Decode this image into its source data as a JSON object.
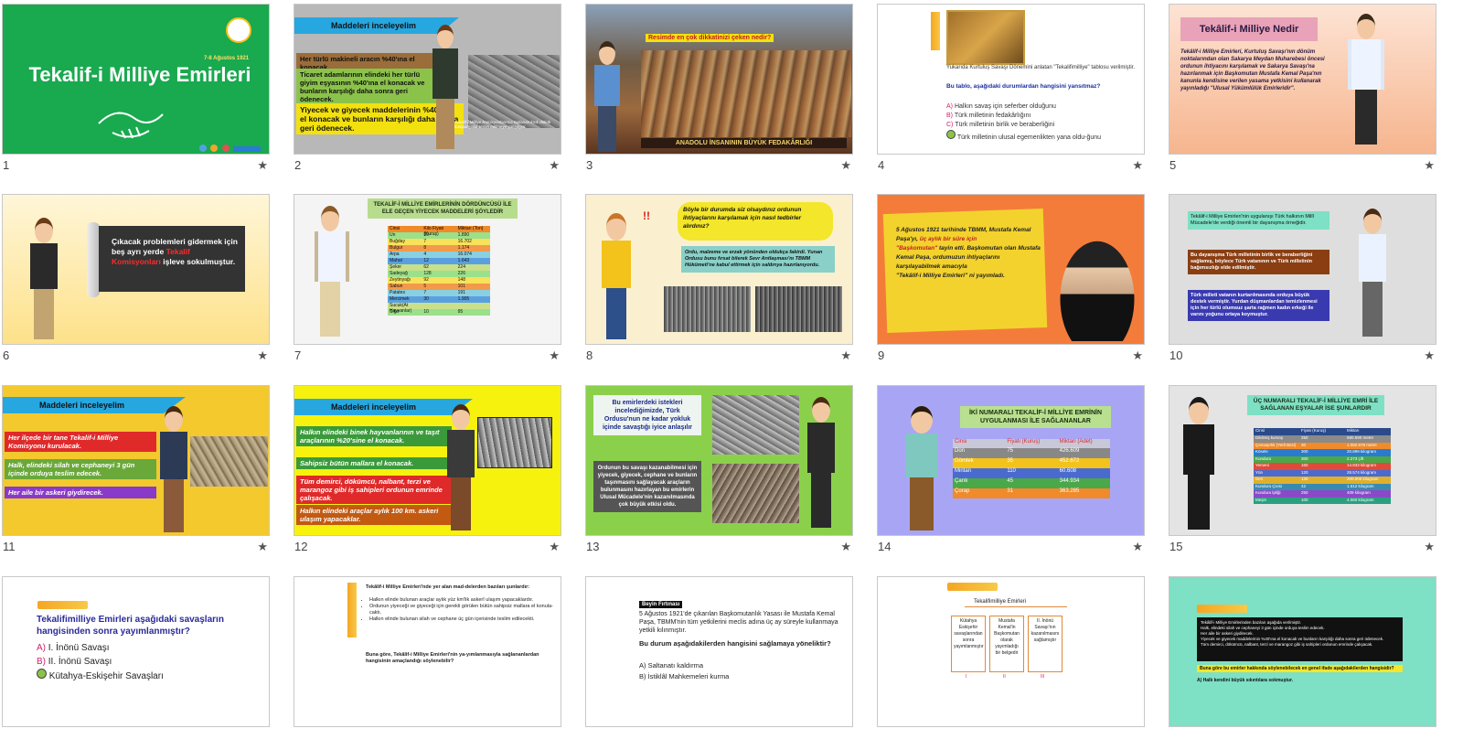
{
  "slides": [
    {
      "num": "1",
      "title": "Tekalif-i Milliye Emirleri",
      "date": "7-8 Ağustos 1921"
    },
    {
      "num": "2",
      "banner": "Maddeleri inceleyelim",
      "lines": [
        "Her türlü makineli aracın %40'ına el konacak.",
        "Ticaret adamlarının elindeki her türlü giyim eşyasının %40'ına el konacak ve bunların karşılığı daha sonra geri ödenecek.",
        "Yiyecek ve giyecek maddelerinin %40'ına el konacak ve bunların karşılığı daha sonra geri ödenecek."
      ],
      "caption": "Tekalif-i Milliye Komisyonlarınca toplanan kırık dökük kampanyalar temin edilmeye çalışılıyor."
    },
    {
      "num": "3",
      "question": "Resimde en çok dikkatinizi çeken nedir?",
      "caption": "ANADOLU İNSANININ BÜYÜK FEDAKÂRLIĞI"
    },
    {
      "num": "4",
      "intro": "Yukarıda Kurtuluş Savaşı Dönemini anlatan \"Tekalifimilliye\" tablosu verilmiştir.",
      "question": "Bu tablo, aşağıdaki durumlardan hangisini yansıtmaz?",
      "options": [
        "Halkın savaş için seferber olduğunu",
        "Türk milletinin fedakârlığını",
        "Türk milletinin birlik ve beraberliğini",
        "Türk milletinin ulusal egemenlikten yana oldu-ğunu"
      ],
      "letters": [
        "A)",
        "B)",
        "C)",
        "D)"
      ]
    },
    {
      "num": "5",
      "title": "Tekâlif-i Milliye Nedir",
      "body": "Tekâlif-i Milliye Emirleri, Kurtuluş Savaşı'nın dönüm noktalarından olan Sakarya Meydan Muharebesi öncesi ordunun ihtiyacını karşılamak ve Sakarya Savaşı'na hazırlanmak için Başkomutan Mustafa Kemal Paşa'nın kanunla kendisine verilen yasama yetkisini kullanarak yayınladığı \"Ulusal Yükümlülük Emirleridir\"."
    },
    {
      "num": "6",
      "text_a": "Çıkacak problemleri gidermek için beş ayrı yerde",
      "text_b": "Tekalif Komisyonları",
      "text_c": "işleve sokulmuştur."
    },
    {
      "num": "7",
      "title": "TEKALİF-İ MİLLİYE EMİRLERİNİN DÖRDÜNCÜSÜ İLE ELE GEÇEN YİYECEK MADDELERİ ŞÖYLEDİR",
      "headers": [
        "Cinsi",
        "Kilo Fiyatı (Kuruş)",
        "Miktarı (Ton)"
      ],
      "rows": [
        [
          "Un",
          "10",
          "1.890"
        ],
        [
          "Buğday",
          "7",
          "16.702"
        ],
        [
          "Bulgur",
          "8",
          "1.174"
        ],
        [
          "Arpa",
          "4",
          "16.074"
        ],
        [
          "Mahut",
          "12",
          "1.643"
        ],
        [
          "Şeker",
          "62",
          "224"
        ],
        [
          "Sadeyağ",
          "128",
          "226"
        ],
        [
          "Zeytinyağı",
          "92",
          "148"
        ],
        [
          "Sabun",
          "5",
          "101"
        ],
        [
          "Patates",
          "7",
          "191"
        ],
        [
          "Mercimek",
          "30",
          "1.905"
        ],
        [
          "Sucuk(At Hayvanlar)",
          "",
          ""
        ],
        [
          "Sığır",
          "10",
          "95"
        ]
      ]
    },
    {
      "num": "8",
      "question": "Böyle bir durumda siz olsaydınız ordunun ihtiyaçlarını karşılamak için nasıl tedbirler alırdınız?",
      "answer": "Ordu, malzeme ve erzak yönünden oldukça fakirdi. Yunan Ordusu bunu fırsat bilerek Sevr Antlaşması'nı TBMM Hükümeti'ne kabul ettirmek için saldırıya hazırlanıyordu."
    },
    {
      "num": "9",
      "p1": "5 Ağustos 1921 tarihinde TBMM, Mustafa Kemal Paşa'yı,",
      "p2": "üç aylık bir süre için",
      "p3": "\"Başkomutan\"",
      "p4": "tayin etti. Başkomutan olan Mustafa Kemal Paşa, ordumuzun ihtiyaçlarını karşılayabilmek amacıyla",
      "p5": "\"Tekâlif-i Milliye Emirleri\" ni yayımladı."
    },
    {
      "num": "10",
      "b1": "Tekâlif-i Milliye Emirleri'nin uygulanışı Türk halkının Millî Mücadele'de verdiği önemli bir dayanışma örneğidir.",
      "b2": "Bu dayanışma Türk milletinin birlik ve beraberliğini sağlamış, böylece Türk vatanının ve Türk milletinin bağımsızlığı elde edilmiştir.",
      "b3": "Türk milleti vatanın kurtarılmasında orduya büyük destek vermiştir. Yurdan düşmanlardan temizlenmesi için her türlü olumsuz şarta rağmen kadın erkeği ile varını yoğunu ortaya koymuştur."
    },
    {
      "num": "11",
      "banner": "Maddeleri inceleyelim",
      "lines": [
        "Her ilçede bir tane Tekalif-i Milliye Komisyonu kurulacak.",
        "Halk, elindeki silah ve cephaneyi 3 gün içinde orduya teslim edecek.",
        "Her aile bir askeri giydirecek."
      ]
    },
    {
      "num": "12",
      "banner": "Maddeleri inceleyelim",
      "lines": [
        "Halkın elindeki binek hayvanlarının ve taşıt araçlarının %20'sine el konacak.",
        "Sahipsiz bütün mallara el konacak.",
        "Tüm demirci, dökümcü, nalbant, terzi ve marangoz gibi iş sahipleri ordunun emrinde çalışacak.",
        "Halkın elindeki araçlar aylık 100 km. askeri ulaşım yapacaklar."
      ]
    },
    {
      "num": "13",
      "q": "Bu emirlerdeki istekleri incelediğimizde, Türk Ordusu'nun ne kadar yokluk içinde savaştığı iyice anlaşılır",
      "a": "Ordunun bu savaşı kazanabilmesi için yiyecek, giyecek, cephane ve bunların taşınmasını sağlayacak araçların bulunmasını hazırlayan bu emirlerin Ulusal Mücadele'nin kazanılmasında çok büyük etkisi oldu."
    },
    {
      "num": "14",
      "title": "İKİ NUMARALI TEKALİF-İ MİLLİYE EMRİNİN UYGULANMASI İLE SAĞLANANLAR",
      "headers": [
        "Cinsi",
        "Fiyatı (Kuruş)",
        "Miktarı (Adet)"
      ],
      "rows": [
        [
          "Don",
          "75",
          "426.609"
        ],
        [
          "Gömlek",
          "35",
          "452.672"
        ],
        [
          "Mintan",
          "110",
          "60.608"
        ],
        [
          "Çarık",
          "45",
          "344.934"
        ],
        [
          "Çorap",
          "31",
          "363.285"
        ]
      ]
    },
    {
      "num": "15",
      "title": "ÜÇ NUMARALI TEKALİF-İ MİLLİYE EMRİ İLE SAĞLANAN EŞYALAR İSE ŞUNLARDIR",
      "headers": [
        "Cinsi",
        "Fiyatı (Kuruş)",
        "Miktarı"
      ],
      "rows": [
        [
          "Dikilmiş kumaş",
          "250",
          "580.590 metre"
        ],
        [
          "Çamaşırlık (Yerli Bezi)",
          "30",
          "1.082.578 metre"
        ],
        [
          "Kösele",
          "300",
          "20.899 kilogram"
        ],
        [
          "Kundura",
          "300",
          "2.273 çift"
        ],
        [
          "Yemeni",
          "160",
          "14.833 kilogram"
        ],
        [
          "Yün",
          "120",
          "28.574 kilogram"
        ],
        [
          "Deri",
          "130",
          "200.000 kilogram"
        ],
        [
          "Kundura Çivisi",
          "42",
          "1.512 kilogram"
        ],
        [
          "Kundura İpliği",
          "250",
          "409 kilogram"
        ],
        [
          "Meşin",
          "100",
          "4.060 kilogram"
        ]
      ]
    },
    {
      "num": "16",
      "q": "Tekalifimilliye Emirleri aşağıdaki savaşların hangisinden sonra yayımlanmıştır?",
      "options": [
        "I. İnönü Savaşı",
        "II. İnönü Savaşı",
        "Kütahya-Eskişehir Savaşları"
      ],
      "letters": [
        "A)",
        "B)",
        "C)"
      ]
    },
    {
      "num": "17",
      "intro": "Tekâlif-i Milliye Emirleri'nde yer alan mad-delerden bazıları şunlardır:",
      "items": [
        "Halkın elinde bulunan araçlar aylık yüz km'lik askerî ulaşım yapacaklardır.",
        "Ordunun yiyeceği ve giyeceği için gerekli görülen bütün sahipsiz mallara el konula-caktı.",
        "Halkın elinde bulunan silah ve cephane üç gün içerisinde teslim edilecekti."
      ],
      "q": "Buna göre, Tekâlif-i Milliye Emirleri'nin ya-yımlanmasıyla sağlananlardan hangisinin amaçlandığı söylenebilir?"
    },
    {
      "num": "18",
      "label": "Beyin Fırtınası",
      "text": "5 Ağustos 1921'de çıkarılan Başkomutanlık Yasası ile Mustafa Kemal Paşa, TBMM'nin tüm yetkilerini meclis adına üç ay süreyle kullanmaya yetkili kılınmıştır.",
      "q": "Bu durum aşağıdakilerden hangisini sağlamaya yöneliktir?",
      "opt1": "A) Saltanatı kaldırma",
      "opt2": "B) İstiklâl Mahkemeleri kurma"
    },
    {
      "num": "19",
      "title": "Tekalifimilliye Emirleri",
      "boxes": [
        "Kütahya Eskişehir savaşlarından sonra yayımlanmıştır",
        "Mustafa Kemal'in Başkomutan olarak yayımladığı bir belgedir",
        "II. İnönü Savaşı'nın kazanılmasını sağlamıştır"
      ],
      "marks": [
        "I",
        "II",
        "III"
      ]
    },
    {
      "num": "20",
      "lines": [
        "Tekâlif-i Milliye Emirlerinden bazıları aşağıda verilmiştir.",
        "Halk, elindeki silah ve cephaneyi 3 gün içinde orduya teslim edecek.",
        "Her aile bir askeri giydirecek.",
        "Yiyecek ve giyecek maddelerinin %40'ına el konacak ve bunların karşılığı daha sonra geri ödenecek.",
        "Tüm demirci, dökümcü, nalbant, terzi ve marangoz gibi iş sahipleri ordunun emrinde çalışacak."
      ],
      "q": "Buna göre bu emirler hakkında söylenebilecek en genel ifade aşağıdakilerden hangisidir?",
      "opt": "A) Halk kendini büyük sıkıntılara sokmuştur."
    }
  ],
  "star": "★"
}
